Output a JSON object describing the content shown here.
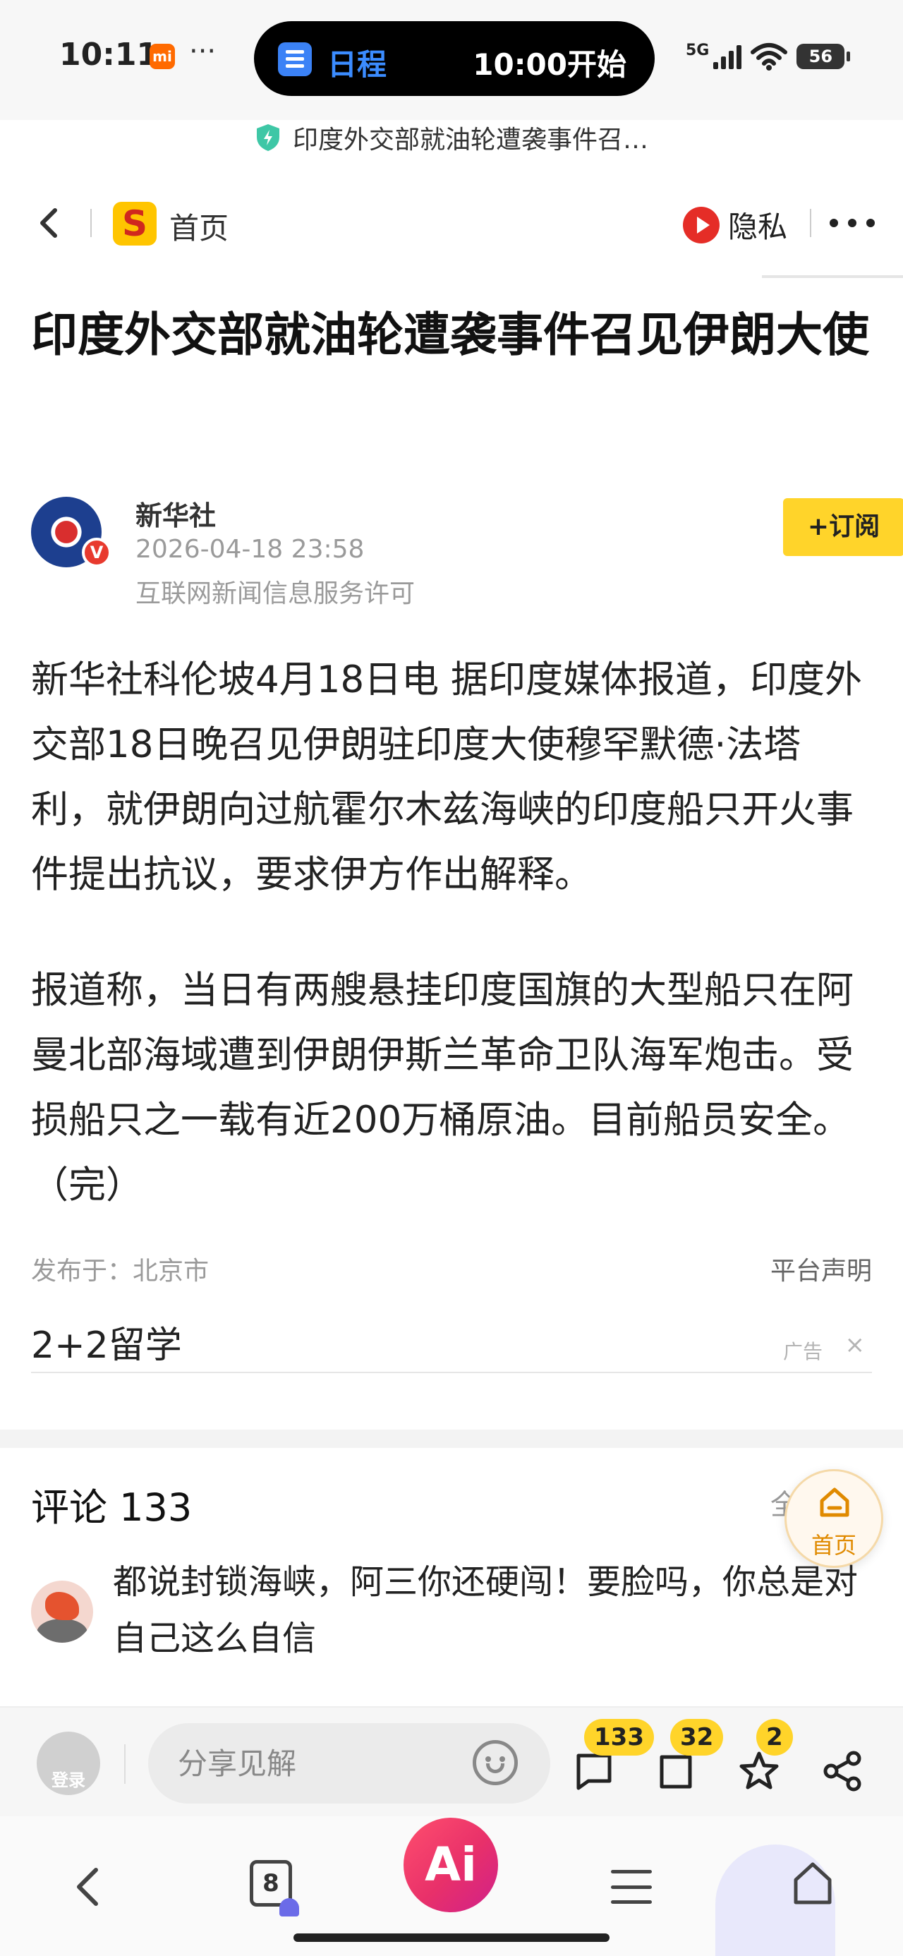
{
  "status_bar": {
    "time": "10:11",
    "brand_badge": "mi",
    "more": "···",
    "island": {
      "label": "日程",
      "time": "10:00开始"
    },
    "network": "5G",
    "battery": "56",
    "url_title": "印度外交部就油轮遭袭事件召…"
  },
  "nav": {
    "home_label": "首页",
    "logo_letter": "S",
    "privacy_label": "隐私"
  },
  "article": {
    "title": "印度外交部就油轮遭袭事件召见伊朗大使",
    "author": {
      "name": "新华社",
      "verified_badge": "V",
      "date": "2026-04-18 23:58",
      "license": "互联网新闻信息服务许可"
    },
    "subscribe_label": "+订阅",
    "paragraphs": [
      "新华社科伦坡4月18日电 据印度媒体报道，印度外交部18日晚召见伊朗驻印度大使穆罕默德·法塔利，就伊朗向过航霍尔木兹海峡的印度船只开火事件提出抗议，要求伊方作出解释。",
      "报道称，当日有两艘悬挂印度国旗的大型船只在阿曼北部海域遭到伊朗伊斯兰革命卫队海军炮击。受损船只之一载有近200万桶原油。目前船员安全。（完）"
    ],
    "published_at": "发布于：北京市",
    "disclaimer": "平台声明"
  },
  "ad": {
    "title": "2+2留学",
    "tag": "广告",
    "close": "×"
  },
  "comments": {
    "title": "评论 133",
    "all_label": "全",
    "home_float_label": "首页",
    "items": [
      {
        "text": "都说封锁海峡，阿三你还硬闯！要脸吗，你总是对自己这么自信"
      }
    ]
  },
  "action_bar": {
    "login_label": "登录",
    "share_placeholder": "分享见解",
    "comment_count": "133",
    "favorite_count": "32",
    "star_count": "2"
  },
  "toolbar": {
    "tab_count": "8",
    "ai_label": "Ai"
  }
}
